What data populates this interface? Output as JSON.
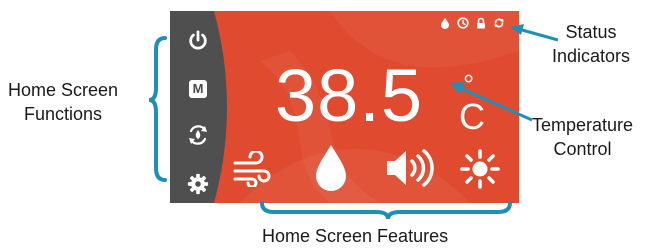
{
  "labels": {
    "home_functions_line1": "Home Screen",
    "home_functions_line2": "Functions",
    "status_line1": "Status",
    "status_line2": "Indicators",
    "temperature_line1": "Temperature",
    "temperature_line2": "Control",
    "features": "Home Screen Features"
  },
  "thermostat": {
    "temperature": "38.5",
    "degree_symbol": "°",
    "unit": "C",
    "sidebar_buttons": [
      {
        "icon": "power-icon"
      },
      {
        "icon": "mode-m-icon",
        "label": "M"
      },
      {
        "icon": "eco-cycle-icon"
      },
      {
        "icon": "gear-icon"
      }
    ],
    "status_icons": [
      "droplet-icon",
      "clock-icon",
      "lock-icon",
      "refresh-icon"
    ],
    "features": [
      "fan-icon",
      "humidity-icon",
      "speaker-icon",
      "brightness-icon"
    ]
  },
  "colors": {
    "screen_bg": "#e04a2e",
    "sidebar_bg": "#4f4f4f",
    "accent_lines": "#1f8fb8",
    "icons": "#ffffff"
  }
}
